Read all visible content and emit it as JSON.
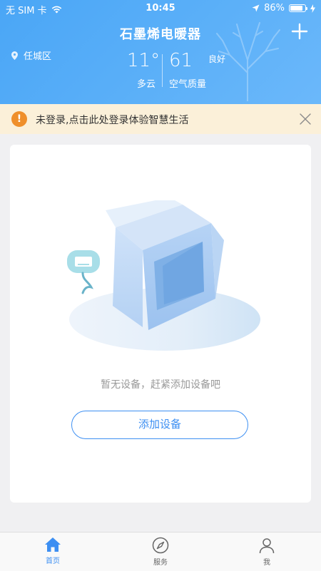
{
  "status_bar": {
    "carrier": "无 SIM 卡",
    "time": "10:45",
    "battery": "86%",
    "battery_level": 0.86
  },
  "header": {
    "title": "石墨烯电暖器",
    "location": "任城区",
    "temperature": "11°",
    "weather": "多云",
    "aqi_value": "61",
    "aqi_level": "良好",
    "aqi_label": "空气质量"
  },
  "notice": {
    "text": "未登录,点击此处登录体验智慧生活",
    "icon_glyph": "!"
  },
  "empty_state": {
    "message": "暂无设备，赶紧添加设备吧",
    "button_label": "添加设备"
  },
  "tabbar": {
    "tabs": [
      {
        "label": "首页",
        "icon": "home-icon",
        "active": true
      },
      {
        "label": "服务",
        "icon": "compass-icon",
        "active": false
      },
      {
        "label": "我",
        "icon": "user-icon",
        "active": false
      }
    ]
  },
  "colors": {
    "accent": "#3d8ff2",
    "header_gradient_start": "#4aa6f6",
    "notice_bg": "#fbf0d9",
    "notice_icon": "#ef8f2b"
  }
}
